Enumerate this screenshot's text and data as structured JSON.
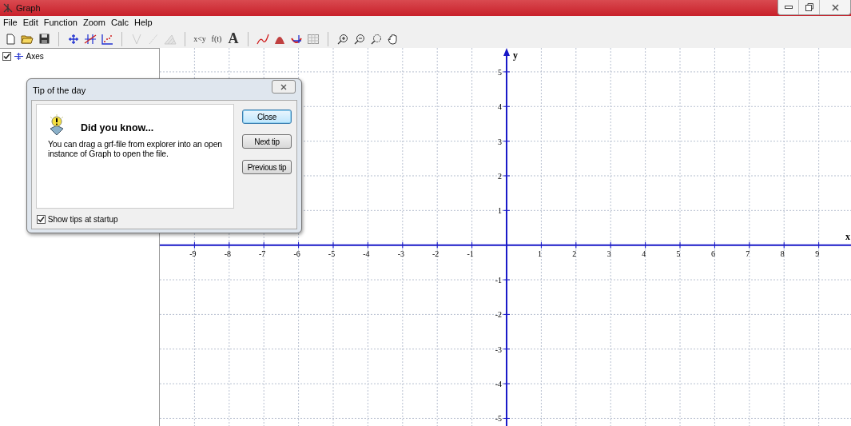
{
  "window": {
    "title": "Graph"
  },
  "menu": [
    {
      "label": "File"
    },
    {
      "label": "Edit"
    },
    {
      "label": "Function"
    },
    {
      "label": "Zoom"
    },
    {
      "label": "Calc"
    },
    {
      "label": "Help"
    }
  ],
  "toolbar": [
    {
      "disabled": false
    },
    {
      "disabled": false
    },
    {
      "disabled": false
    },
    {
      "separator": true
    },
    {
      "disabled": false
    },
    {
      "disabled": false
    },
    {
      "disabled": false
    },
    {
      "separator": true
    },
    {
      "disabled": true
    },
    {
      "disabled": true
    },
    {
      "disabled": true
    },
    {
      "separator": true
    },
    {
      "label": "x<y",
      "disabled": false
    },
    {
      "label": "f(t)",
      "disabled": false
    },
    {
      "label": "A",
      "disabled": false
    },
    {
      "separator": true
    },
    {
      "disabled": false
    },
    {
      "disabled": false
    },
    {
      "disabled": false
    },
    {
      "disabled": false
    },
    {
      "separator": true
    },
    {
      "disabled": false
    },
    {
      "disabled": false
    },
    {
      "disabled": false
    },
    {
      "disabled": false
    }
  ],
  "tree": [
    {
      "label": "Axes",
      "checked": true
    }
  ],
  "plot": {
    "chart_data": {
      "type": "line",
      "grid": true,
      "xlabel": "x",
      "ylabel": "y",
      "xlim": [
        -10,
        9.93
      ],
      "ylim": [
        -5.22,
        5.69
      ],
      "xticks": [
        -9,
        -8,
        -7,
        -6,
        -5,
        -4,
        -3,
        -2,
        -1,
        1,
        2,
        3,
        4,
        5,
        6,
        7,
        8,
        9
      ],
      "yticks": [
        5,
        4,
        3,
        2,
        1,
        -1,
        -2,
        -3,
        -4,
        -5
      ]
    }
  },
  "dialog": {
    "title": "Tip of the day",
    "heading": "Did you know...",
    "text": "You can drag a grf-file from explorer into an open instance of Graph to open the file.",
    "buttons": [
      {
        "label": "Close",
        "selected": true
      },
      {
        "label": "Next tip",
        "selected": false
      },
      {
        "label": "Previous tip",
        "selected": false
      }
    ],
    "show_tips": {
      "label": "Show tips at startup",
      "checked": true
    }
  }
}
